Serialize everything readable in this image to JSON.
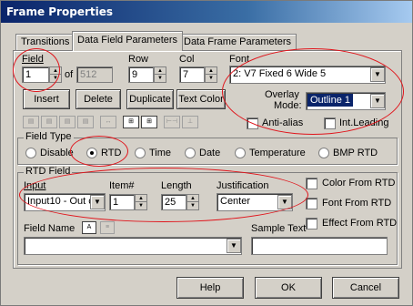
{
  "window": {
    "title": "Frame Properties"
  },
  "tabs": [
    {
      "label": "Transitions"
    },
    {
      "label": "Data Field Parameters"
    },
    {
      "label": "Data Frame Parameters"
    }
  ],
  "field": {
    "label": "Field",
    "value": "1",
    "of_label": "of",
    "total": "512",
    "row_label": "Row",
    "row_value": "9",
    "col_label": "Col",
    "col_value": "7",
    "font_label": "Font",
    "font_value": "2: V7 Fixed  6 Wide  5"
  },
  "buttons": {
    "insert": "Insert",
    "delete": "Delete",
    "duplicate": "Duplicate",
    "text_color": "Text Color"
  },
  "overlay": {
    "label_line1": "Overlay",
    "label_line2": "Mode:",
    "value": "Outline 1"
  },
  "options": {
    "anti_alias": "Anti-alias",
    "int_leading": "Int.Leading"
  },
  "field_type": {
    "group_label": "Field Type",
    "options": [
      "Disable",
      "RTD",
      "Time",
      "Date",
      "Temperature",
      "BMP RTD"
    ],
    "selected": "RTD"
  },
  "rtd": {
    "group_label": "RTD Field",
    "input_label": "Input",
    "input_value": "Input10 - Out c",
    "item_label": "Item#",
    "item_value": "1",
    "length_label": "Length",
    "length_value": "25",
    "justification_label": "Justification",
    "justification_value": "Center",
    "color_from_rtd": "Color From RTD",
    "font_from_rtd": "Font From RTD",
    "effect_from_rtd": "Effect From RTD"
  },
  "field_name": {
    "label": "Field Name",
    "value": ""
  },
  "sample_text": {
    "label": "Sample Text",
    "value": ""
  },
  "footer": {
    "help": "Help",
    "ok": "OK",
    "cancel": "Cancel"
  }
}
